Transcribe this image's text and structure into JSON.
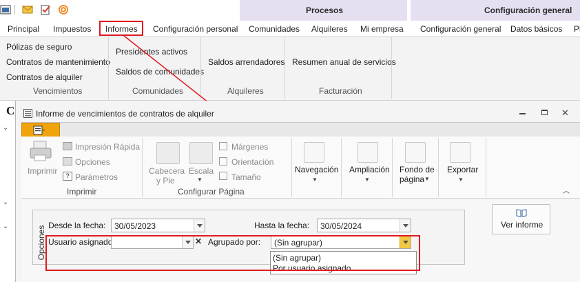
{
  "header_groups": {
    "procesos": "Procesos",
    "configuracion": "Configuración general"
  },
  "tabs": [
    "Principal",
    "Impuestos",
    "Informes",
    "Configuración personal",
    "Comunidades",
    "Alquileres",
    "Mi empresa",
    "Configuración general",
    "Datos básicos",
    "Pl"
  ],
  "ribbon": {
    "vencimientos": {
      "items": [
        "Pólizas de seguro",
        "Contratos de mantenimiento",
        "Contratos de alquiler"
      ],
      "caption": "Vencimientos"
    },
    "comunidades": {
      "items": [
        "Presidentes activos",
        "Saldos de comunidades"
      ],
      "caption": "Comunidades"
    },
    "alquileres": {
      "items": [
        "Saldos arrendadores"
      ],
      "caption": "Alquileres"
    },
    "facturacion": {
      "items": [
        "Resumen anual de servicios"
      ],
      "caption": "Facturación"
    }
  },
  "left_heading": "C",
  "window": {
    "title": "Informe de vencimientos de contratos de alquiler",
    "imprimir": {
      "print": "Imprimir",
      "quick": "Impresión Rápida",
      "options": "Opciones",
      "params": "Parámetros",
      "caption": "Imprimir"
    },
    "pagina": {
      "cabecera_1": "Cabecera",
      "cabecera_2": "y Pie",
      "escala": "Escala",
      "margenes": "Márgenes",
      "orientacion": "Orientación",
      "tamano": "Tamaño",
      "caption": "Configurar Página"
    },
    "navegacion": "Navegación",
    "ampliacion": "Ampliación",
    "fondo_1": "Fondo de",
    "fondo_2": "página",
    "exportar": "Exportar"
  },
  "options": {
    "section_label": "Opciones",
    "desde_label": "Desde la fecha:",
    "desde_value": "30/05/2023",
    "hasta_label": "Hasta la fecha:",
    "hasta_value": "30/05/2024",
    "usuario_label": "Usuario asignado:",
    "usuario_value": "",
    "agrupado_label": "Agrupado por:",
    "agrupado_value": "(Sin agrupar)",
    "agrupado_options": [
      "(Sin agrupar)",
      "Por usuario asignado"
    ],
    "ver_informe": "Ver informe"
  },
  "colors": {
    "accent_red": "#e0191e",
    "header_purple": "#e6dff1",
    "file_tab_orange": "#f0a30a"
  }
}
